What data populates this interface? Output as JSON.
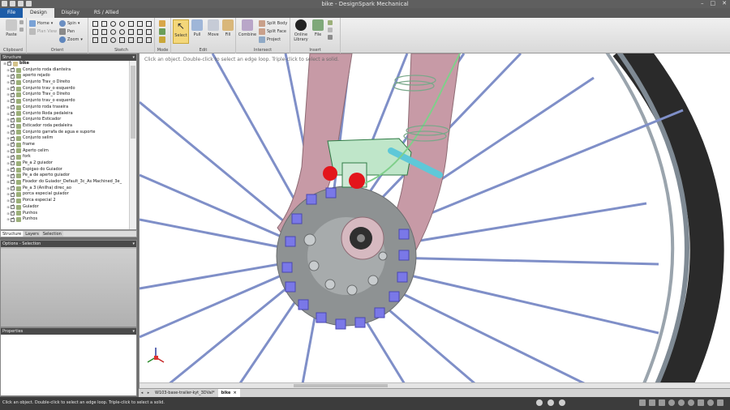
{
  "window": {
    "title": "bike - DesignSpark Mechanical",
    "controls": [
      "–",
      "□",
      "✕"
    ]
  },
  "ribbon": {
    "tabs": [
      {
        "label": "File"
      },
      {
        "label": "Design"
      },
      {
        "label": "Display"
      },
      {
        "label": "RS / Allied"
      }
    ],
    "groups": {
      "clipboard": {
        "label": "Clipboard",
        "paste": "Paste"
      },
      "orient": {
        "label": "Orient",
        "home": "Home",
        "plan_view": "Plan View",
        "spin": "Spin",
        "pan": "Pan",
        "zoom": "Zoom"
      },
      "sketch": {
        "label": "Sketch"
      },
      "mode": {
        "label": "Mode"
      },
      "edit": {
        "label": "Edit",
        "select": "Select",
        "pull": "Pull",
        "move": "Move",
        "fill": "Fill"
      },
      "intersect": {
        "label": "Intersect",
        "combine": "Combine",
        "split_body": "Split Body",
        "split_face": "Split Face",
        "project": "Project"
      },
      "insert": {
        "label": "Insert",
        "online_library": "Online Library",
        "file": "File"
      }
    }
  },
  "structure": {
    "header": "Structure",
    "root": "bike",
    "items": [
      "Conjunto roda dianteira",
      "aperto rejado",
      "Conjunto Trav_o Direito",
      "Conjunto trav_o esquerdo",
      "Conjunto Trav_o Direito",
      "Conjunto trav_o esquerdo",
      "Conjunto roda traseira",
      "Conjunto Roda pedaleira",
      "Conjunto Esticador",
      "Esticador roda pedaleira",
      "Conjunto garrafa de agua e suporte",
      "Conjunto selim",
      "frame",
      "Aperto celim",
      "fork",
      "Pe_a 2 guiador",
      "Espigao do Guiador",
      "Pe_a de aperto guiador",
      "Fixador do Guiador_Default_3c_As Machined_3e_",
      "Pe_a 3 (Anilha) direc_ao",
      "porca especial guiador",
      "Porca especial 2",
      "Guiador",
      "Punhos",
      "Punhos"
    ],
    "panel_tabs": [
      "Structure",
      "Layers",
      "Selection"
    ]
  },
  "options": {
    "header": "Options - Selection"
  },
  "properties": {
    "header": "Properties"
  },
  "viewport": {
    "hint": "Click an object. Double-click to select an edge loop. Triple-click to select a solid."
  },
  "doc_tabs": [
    {
      "label": "W103-base-trailer-kyt_3DVal*"
    },
    {
      "label": "bike"
    }
  ],
  "status": {
    "message": "Click an object. Double-click to select an edge loop. Triple-click to select a solid."
  },
  "colors": {
    "file_tab": "#1e5da8",
    "fork": "#c79aa6",
    "rotor": "#8e9293",
    "rotor_holes": "#7a78e8",
    "caliper": "#bfe6c9",
    "cable": "#5ec8d8",
    "red_cap": "#e3151b",
    "spokes": "#7f8fc8"
  }
}
